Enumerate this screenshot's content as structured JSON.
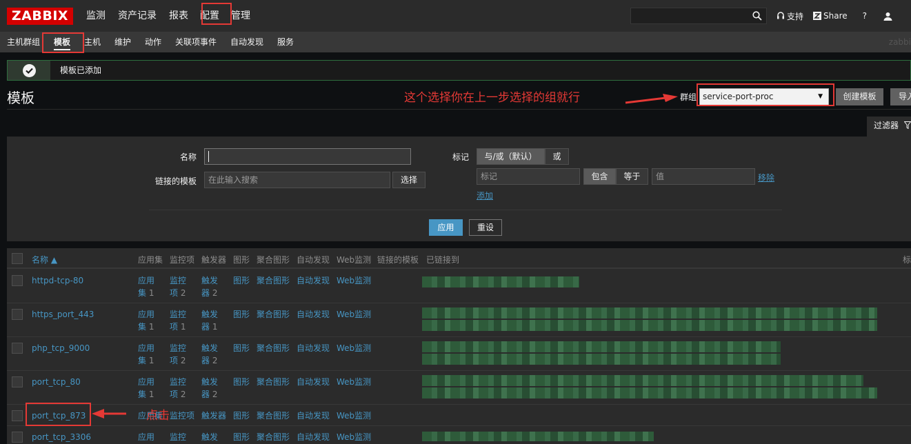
{
  "header": {
    "logo": "ZABBIX",
    "nav": [
      "监测",
      "资产记录",
      "报表",
      "配置",
      "管理"
    ],
    "active_nav": "配置",
    "search_value": "",
    "support": "支持",
    "share": "Share",
    "help": "?"
  },
  "subnav": {
    "items": [
      "主机群组",
      "模板",
      "主机",
      "维护",
      "动作",
      "关联项事件",
      "自动发现",
      "服务"
    ],
    "active": "模板",
    "server": "zabbi"
  },
  "message": {
    "text": "模板已添加"
  },
  "page": {
    "title": "模板",
    "annotation": "这个选择你在上一步选择的组就行",
    "group_label": "群组",
    "group_value": "service-port-proc",
    "create_button": "创建模板",
    "import_button": "导入"
  },
  "filter": {
    "tab_label": "过滤器",
    "name_label": "名称",
    "name_value": "",
    "linked_label": "链接的模板",
    "linked_placeholder": "在此输入搜索",
    "select_button": "选择",
    "tags_label": "标记",
    "and_or": "与/或（默认）",
    "or": "或",
    "tag_placeholder": "标记",
    "contains": "包含",
    "equals": "等于",
    "value_placeholder": "值",
    "remove": "移除",
    "add": "添加",
    "apply": "应用",
    "reset": "重设"
  },
  "table": {
    "columns": [
      "名称 ▲",
      "应用集",
      "监控项",
      "触发器",
      "图形",
      "聚合图形",
      "自动发现",
      "Web监测",
      "链接的模板",
      "已链接到",
      "标"
    ],
    "rows": [
      {
        "name": "httpd-tcp-80",
        "apps": [
          "应用",
          "集"
        ],
        "apps_count": "1",
        "items": [
          "监控",
          "项"
        ],
        "items_count": "2",
        "triggers": [
          "触发",
          "器"
        ],
        "triggers_count": "2",
        "graphs": "图形",
        "screens": "聚合图形",
        "discovery": "自动发现",
        "web": "Web监测"
      },
      {
        "name": "https_port_443",
        "apps": [
          "应用",
          "集"
        ],
        "apps_count": "1",
        "items": [
          "监控",
          "项"
        ],
        "items_count": "1",
        "triggers": [
          "触发",
          "器"
        ],
        "triggers_count": "1",
        "graphs": "图形",
        "screens": "聚合图形",
        "discovery": "自动发现",
        "web": "Web监测"
      },
      {
        "name": "php_tcp_9000",
        "apps": [
          "应用",
          "集"
        ],
        "apps_count": "1",
        "items": [
          "监控",
          "项"
        ],
        "items_count": "2",
        "triggers": [
          "触发",
          "器"
        ],
        "triggers_count": "2",
        "graphs": "图形",
        "screens": "聚合图形",
        "discovery": "自动发现",
        "web": "Web监测"
      },
      {
        "name": "port_tcp_80",
        "apps": [
          "应用",
          "集"
        ],
        "apps_count": "1",
        "items": [
          "监控",
          "项"
        ],
        "items_count": "2",
        "triggers": [
          "触发",
          "器"
        ],
        "triggers_count": "2",
        "graphs": "图形",
        "screens": "聚合图形",
        "discovery": "自动发现",
        "web": "Web监测"
      },
      {
        "name": "port_tcp_873",
        "apps": [
          "应用集"
        ],
        "apps_count": "",
        "items": [
          "监控项"
        ],
        "items_count": "",
        "triggers": [
          "触发器"
        ],
        "triggers_count": "",
        "graphs": "图形",
        "screens": "聚合图形",
        "discovery": "自动发现",
        "web": "Web监测"
      },
      {
        "name": "port_tcp_3306",
        "apps": [
          "应用"
        ],
        "apps_count": "",
        "items": [
          "监控"
        ],
        "items_count": "",
        "triggers": [
          "触发"
        ],
        "triggers_count": "",
        "graphs": "图形",
        "screens": "聚合图形",
        "discovery": "自动发现",
        "web": "Web监测"
      }
    ],
    "click_annotation": "点击"
  },
  "colors": {
    "accent_red": "#d40000",
    "annotation_red": "#e53935",
    "link_blue": "#4796c4",
    "success_green": "#2e6e3e"
  }
}
